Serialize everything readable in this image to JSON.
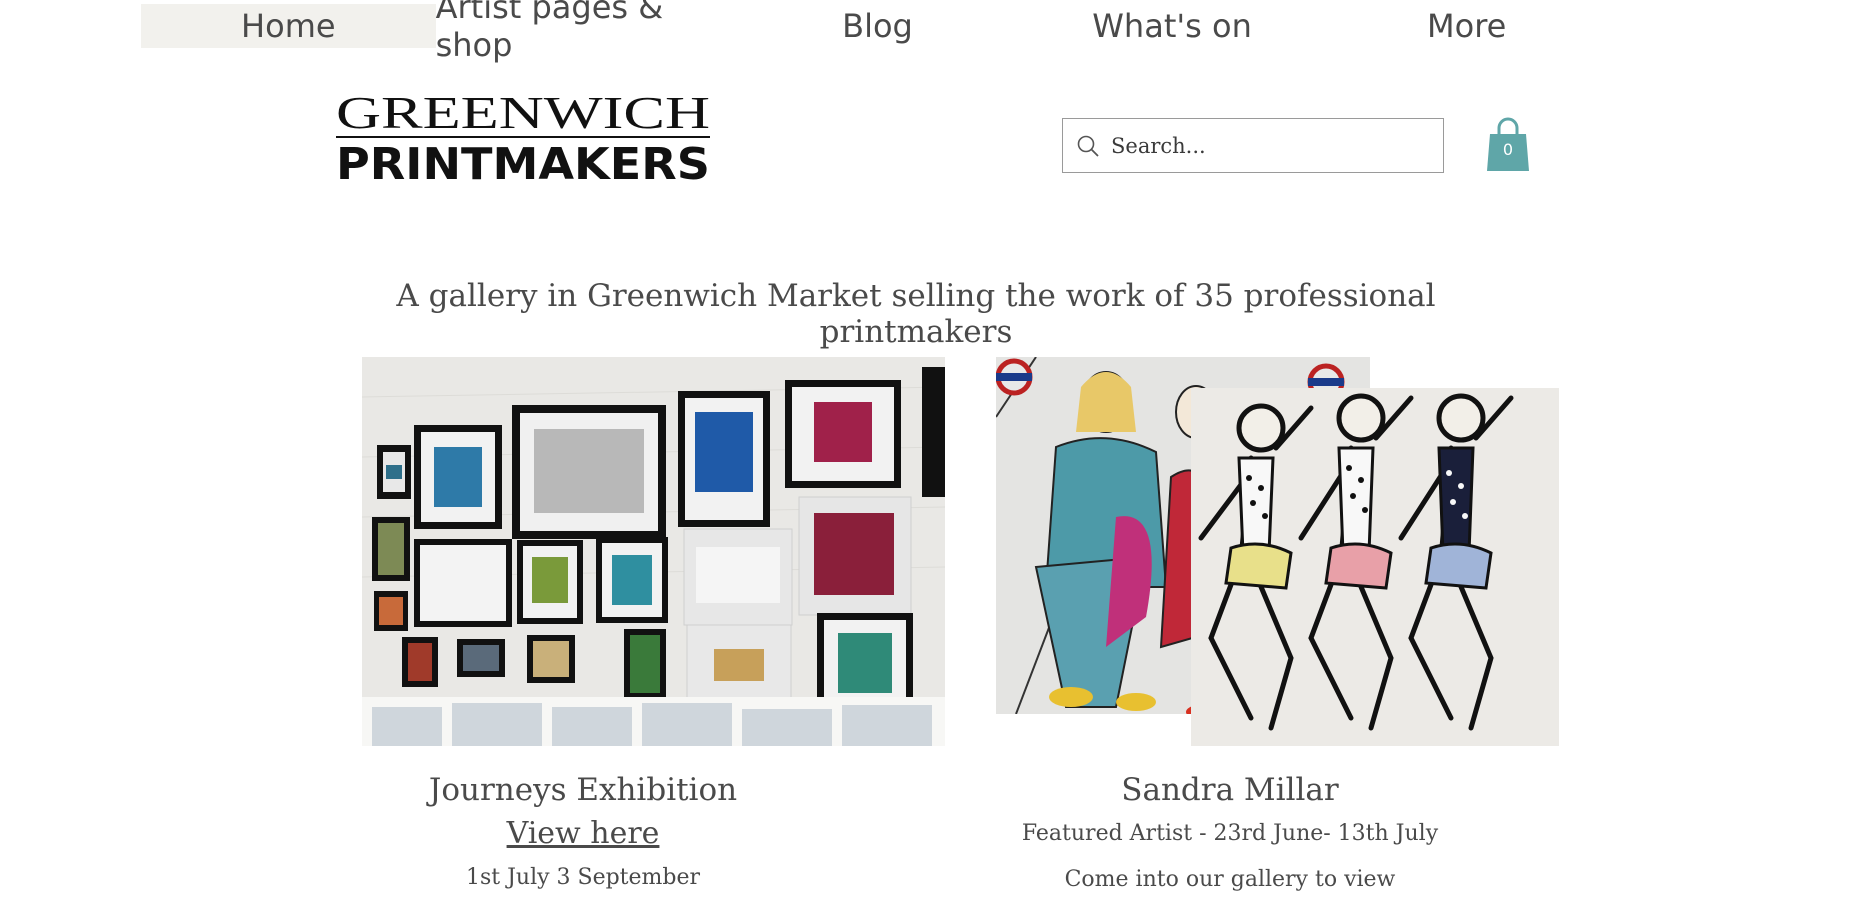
{
  "nav": {
    "items": [
      {
        "label": "Home"
      },
      {
        "label": "Artist pages & shop"
      },
      {
        "label": "Blog"
      },
      {
        "label": "What's on"
      },
      {
        "label": "More"
      }
    ]
  },
  "logo": {
    "line1": "GREENWICH",
    "line2": "PRINTMAKERS"
  },
  "search": {
    "placeholder": "Search..."
  },
  "cart": {
    "count": "0"
  },
  "tagline": "A gallery in Greenwich Market selling the work of 35 professional printmakers",
  "features": [
    {
      "title": "Journeys Exhibition",
      "link": "View here",
      "detail": "1st July 3 September"
    },
    {
      "title": "Sandra Millar",
      "subtitle": "Featured Artist - 23rd June- 13th July",
      "detail": "Come into our gallery to view"
    }
  ],
  "colors": {
    "nav_active_bg": "#f2f1ed",
    "cart": "#5fa6a8",
    "text": "#4a4a4a"
  }
}
